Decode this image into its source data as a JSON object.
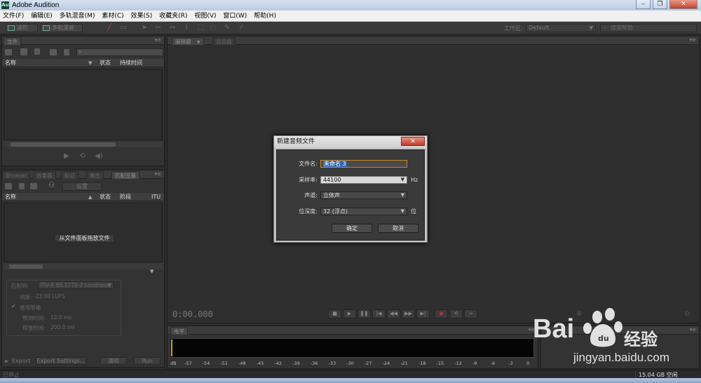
{
  "window": {
    "title": "Adobe Audition",
    "app_icon": "Au",
    "minimize_glyph": "–",
    "maximize_glyph": "❐",
    "close_glyph": "✕"
  },
  "menu": [
    "文件(F)",
    "编辑(E)",
    "多轨混音(M)",
    "素材(C)",
    "效果(S)",
    "收藏夹(R)",
    "视图(V)",
    "窗口(W)",
    "帮助(H)"
  ],
  "toolbar": {
    "waveform_label": "波形",
    "multitrack_label": "多轨混音",
    "workspace_label": "工作区:",
    "workspace_value": "Default",
    "search_placeholder": "搜索帮助"
  },
  "files_panel": {
    "tab": "文件",
    "col_name": "名称",
    "col_status": "状态",
    "col_duration": "持续时间"
  },
  "match_panel": {
    "tabs": [
      "Browser",
      "效果器",
      "标记",
      "属性",
      "匹配音量"
    ],
    "settings_button": "设置",
    "col_name": "名称",
    "col_status": "状态",
    "col_stage": "阶段",
    "col_itu": "ITU",
    "drop_hint": "从文件面板拖放文件",
    "match_to_label": "匹配到:",
    "match_to_value": "ITU-R BS.1770-2 Loudness",
    "loudness_label": "响度:",
    "loudness_value": "-23.00 LUFS",
    "limiter_label": "使用限幅",
    "lookahead_label": "预测时间:",
    "lookahead_value": "12.0 ms",
    "release_label": "释放时间:",
    "release_value": "200.0 ms",
    "export_button": "Export",
    "export_settings_button": "Export Settings...",
    "clear_button": "清除",
    "run_button": "Run"
  },
  "editor": {
    "tab_editor": "编辑器",
    "tab_mixer": "混音器",
    "time": "0:00.000"
  },
  "dialog": {
    "title": "新建音频文件",
    "close_glyph": "✕",
    "filename_label": "文件名:",
    "filename_value": "未命名 3",
    "samplerate_label": "采样率:",
    "samplerate_value": "44100",
    "samplerate_unit": "Hz",
    "channels_label": "声道:",
    "channels_value": "立体声",
    "bitdepth_label": "位深度:",
    "bitdepth_value": "32 (浮点)",
    "bitdepth_unit": "位",
    "ok_button": "确定",
    "cancel_button": "取消"
  },
  "levels_panel": {
    "tab": "电平",
    "db_label": "dB",
    "ticks": [
      "-57",
      "-54",
      "-51",
      "-48",
      "-45",
      "-42",
      "-39",
      "-36",
      "-33",
      "-30",
      "-27",
      "-24",
      "-21",
      "-18",
      "-15",
      "-12",
      "-9",
      "-6",
      "-3",
      "0"
    ]
  },
  "statusbar": {
    "left": "已停止",
    "free_space": "15.04 GB 空闲"
  },
  "watermark": {
    "brand": "Bai",
    "brand_cn": "经验",
    "url": "jingyan.baidu.com"
  }
}
